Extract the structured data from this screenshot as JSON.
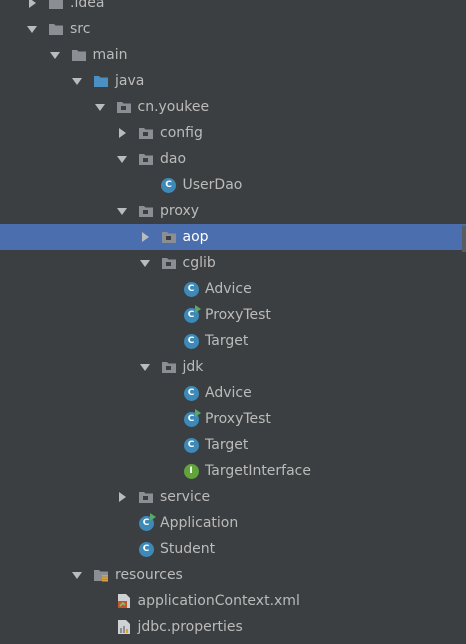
{
  "colors": {
    "background": "#3c3f41",
    "selection": "#4b6eaf",
    "text": "#bbbbbb",
    "folder": "#8b8f93",
    "source_folder": "#4a90c2",
    "class_badge": "#3d8ab8",
    "interface_badge": "#62a33b",
    "run_marker": "#59a869"
  },
  "tree": {
    "items": [
      {
        "label": ".idea",
        "icon": "folder-icon",
        "expanded": false,
        "children": true
      },
      {
        "label": "src",
        "icon": "folder-icon",
        "expanded": true,
        "children": true
      },
      {
        "label": "main",
        "icon": "folder-icon",
        "expanded": true,
        "children": true
      },
      {
        "label": "java",
        "icon": "source-folder-icon",
        "expanded": true,
        "children": true
      },
      {
        "label": "cn.youkee",
        "icon": "package-icon",
        "expanded": true,
        "children": true
      },
      {
        "label": "config",
        "icon": "package-icon",
        "expanded": false,
        "children": true
      },
      {
        "label": "dao",
        "icon": "package-icon",
        "expanded": true,
        "children": true
      },
      {
        "label": "UserDao",
        "icon": "class-icon",
        "children": false
      },
      {
        "label": "proxy",
        "icon": "package-icon",
        "expanded": true,
        "children": true
      },
      {
        "label": "aop",
        "icon": "package-icon",
        "expanded": false,
        "children": true,
        "selected": true
      },
      {
        "label": "cglib",
        "icon": "package-icon",
        "expanded": true,
        "children": true
      },
      {
        "label": "Advice",
        "icon": "class-icon",
        "children": false
      },
      {
        "label": "ProxyTest",
        "icon": "runnable-class-icon",
        "children": false
      },
      {
        "label": "Target",
        "icon": "class-icon",
        "children": false
      },
      {
        "label": "jdk",
        "icon": "package-icon",
        "expanded": true,
        "children": true
      },
      {
        "label": "Advice",
        "icon": "class-icon",
        "children": false
      },
      {
        "label": "ProxyTest",
        "icon": "runnable-class-icon",
        "children": false
      },
      {
        "label": "Target",
        "icon": "class-icon",
        "children": false
      },
      {
        "label": "TargetInterface",
        "icon": "interface-icon",
        "children": false
      },
      {
        "label": "service",
        "icon": "package-icon",
        "expanded": false,
        "children": true
      },
      {
        "label": "Application",
        "icon": "runnable-class-icon",
        "children": false
      },
      {
        "label": "Student",
        "icon": "class-icon",
        "children": false
      },
      {
        "label": "resources",
        "icon": "resources-folder-icon",
        "expanded": true,
        "children": true
      },
      {
        "label": "applicationContext.xml",
        "icon": "xml-file-icon",
        "children": false
      },
      {
        "label": "jdbc.properties",
        "icon": "properties-file-icon",
        "children": false
      }
    ]
  }
}
